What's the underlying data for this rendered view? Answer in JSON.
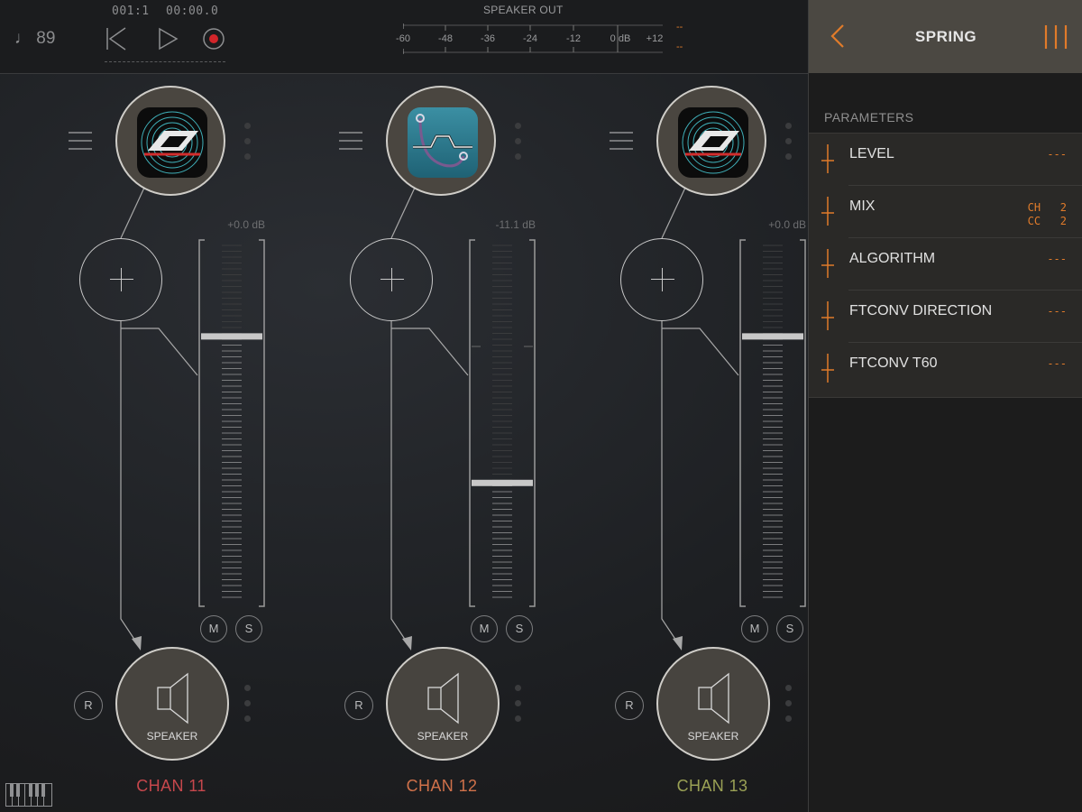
{
  "transport": {
    "tempo": "♩ 89",
    "bar_beat": "001:1",
    "time": "00:00.0",
    "rewind_icon": "skip-back-icon",
    "play_icon": "play-icon",
    "record_icon": "record-icon"
  },
  "speaker_out": {
    "title": "SPEAKER OUT",
    "ticks": [
      "-60",
      "-48",
      "-36",
      "-24",
      "-12",
      "0 dB",
      "+12"
    ],
    "peak_left": "--",
    "peak_right": "--"
  },
  "panel": {
    "title": "SPRING",
    "back_icon": "chevron-left-icon",
    "menu_icon": "bars-icon",
    "section_label": "PARAMETERS",
    "params": [
      {
        "name": "LEVEL",
        "value": "---"
      },
      {
        "name": "MIX",
        "value_line1": "CH   2",
        "value_line2": "CC   2"
      },
      {
        "name": "ALGORITHM",
        "value": "---"
      },
      {
        "name": "FTCONV DIRECTION",
        "value": "---"
      },
      {
        "name": "FTCONV T60",
        "value": "---"
      }
    ]
  },
  "channels": [
    {
      "name": "CHAN 11",
      "color": "#c6474c",
      "db": "+0.0 dB",
      "fader_level": 0.738,
      "plugin_icon": "reverb-plugin-icon",
      "mute": "M",
      "solo": "S",
      "record": "R",
      "output": "SPEAKER"
    },
    {
      "name": "CHAN 12",
      "color": "#d0714a",
      "db": "-11.1 dB",
      "fader_level": 0.338,
      "plugin_icon": "spring-plugin-icon",
      "mute": "M",
      "solo": "S",
      "record": "R",
      "output": "SPEAKER"
    },
    {
      "name": "CHAN 13",
      "color": "#9aa155",
      "db": "+0.0 dB",
      "fader_level": 0.738,
      "plugin_icon": "reverb-plugin-icon",
      "mute": "M",
      "solo": "S",
      "record": "R",
      "output": "SPEAKER"
    }
  ],
  "colors": {
    "accent": "#e07b2a",
    "panel_header": "#4b4842"
  },
  "keyboard_icon": "piano-keyboard-icon"
}
